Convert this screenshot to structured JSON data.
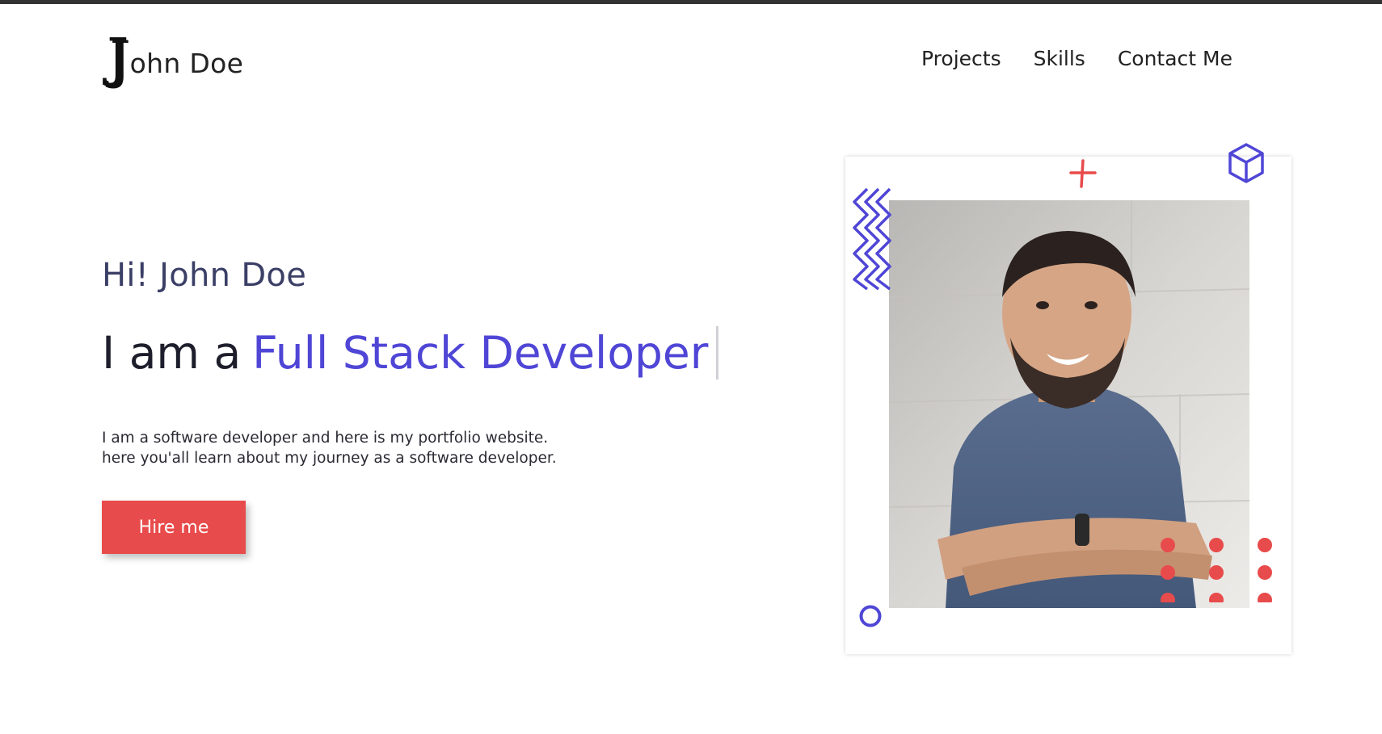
{
  "brand": {
    "initial": "J",
    "rest": "ohn Doe"
  },
  "nav": {
    "items": [
      "Projects",
      "Skills",
      "Contact Me"
    ]
  },
  "hero": {
    "greeting": "Hi! John Doe",
    "headline_prefix": "I am a",
    "headline_role": "Full Stack Developer",
    "description_line1": "I am a software developer and here is my portfolio website.",
    "description_line2": "here you'all learn about my journey as a software developer.",
    "cta_label": "Hire me"
  },
  "colors": {
    "accent": "#4f46d6",
    "cta": "#e84b4b",
    "decor_blue": "#4f46d6",
    "decor_red": "#e84b4b"
  },
  "icons": [
    "plus-icon",
    "cube-icon",
    "zigzag-decoration",
    "circle-decoration",
    "dot-grid-decoration"
  ]
}
